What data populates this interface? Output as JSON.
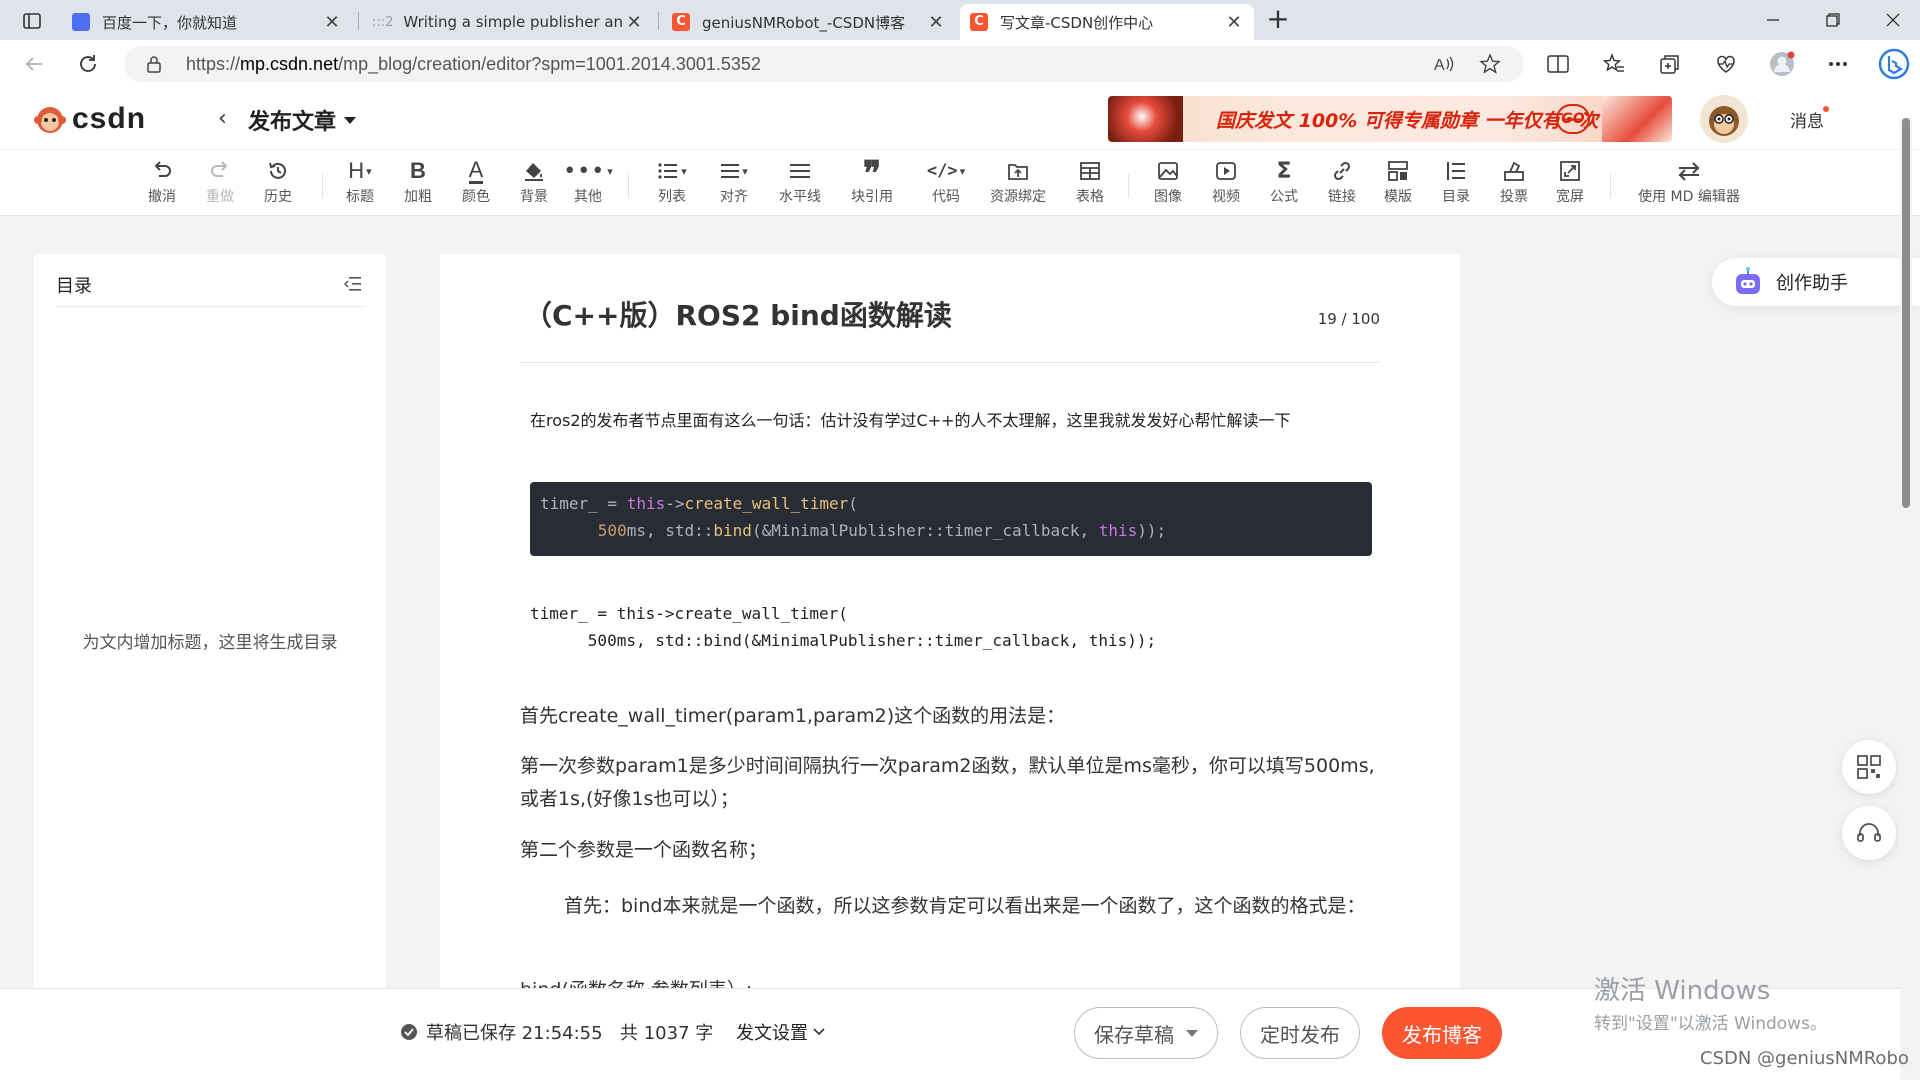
{
  "browser": {
    "tabs": [
      {
        "title": "百度一下，你就知道",
        "favicon_color": "#4e6ef2"
      },
      {
        "title": "Writing a simple publisher and su",
        "favicon_color": "#9aa0a6",
        "prefix": ":::2"
      },
      {
        "title": "geniusNMRobot_-CSDN博客",
        "favicon_color": "#fc5531"
      },
      {
        "title": "写文章-CSDN创作中心",
        "favicon_color": "#fc5531"
      }
    ],
    "url_prefix": "https://",
    "url_domain": "mp.csdn.net",
    "url_rest": "/mp_blog/creation/editor?spm=1001.2014.3001.5352"
  },
  "header": {
    "logo_text": "CSDN",
    "publish_title": "发布文章",
    "banner_text": "国庆发文 100% 可得专属勋章 一年仅有一次",
    "banner_go": "GO",
    "messages": "消息"
  },
  "toolbar": {
    "items": [
      {
        "label": "撤消",
        "icon": "undo-icon"
      },
      {
        "label": "重做",
        "icon": "redo-icon"
      },
      {
        "label": "历史",
        "icon": "history-icon"
      },
      {
        "label": "标题",
        "icon": "heading-icon"
      },
      {
        "label": "加粗",
        "icon": "bold-icon"
      },
      {
        "label": "颜色",
        "icon": "font-color-icon"
      },
      {
        "label": "背景",
        "icon": "background-icon"
      },
      {
        "label": "其他",
        "icon": "more-icon"
      },
      {
        "label": "列表",
        "icon": "list-icon"
      },
      {
        "label": "对齐",
        "icon": "align-icon"
      },
      {
        "label": "水平线",
        "icon": "horizontal-rule-icon"
      },
      {
        "label": "块引用",
        "icon": "blockquote-icon"
      },
      {
        "label": "代码",
        "icon": "code-icon"
      },
      {
        "label": "资源绑定",
        "icon": "resource-icon"
      },
      {
        "label": "表格",
        "icon": "table-icon"
      },
      {
        "label": "图像",
        "icon": "image-icon"
      },
      {
        "label": "视频",
        "icon": "video-icon"
      },
      {
        "label": "公式",
        "icon": "formula-icon"
      },
      {
        "label": "链接",
        "icon": "link-icon"
      },
      {
        "label": "模版",
        "icon": "template-icon"
      },
      {
        "label": "目录",
        "icon": "toc-icon"
      },
      {
        "label": "投票",
        "icon": "vote-icon"
      },
      {
        "label": "宽屏",
        "icon": "widescreen-icon"
      },
      {
        "label": "使用 MD 编辑器",
        "icon": "switch-md-icon"
      }
    ]
  },
  "toc": {
    "title": "目录",
    "empty_hint": "为文内增加标题，这里将生成目录"
  },
  "article": {
    "title": "（C++版）ROS2 bind函数解读",
    "title_count": "19 / 100",
    "intro": "在ros2的发布者节点里面有这么一句话：估计没有学过C++的人不太理解，这里我就发发好心帮忙解读一下",
    "code_lines": [
      "timer_ = this->create_wall_timer(",
      "      500ms, std::bind(&MinimalPublisher::timer_callback, this));"
    ],
    "para1": "首先create_wall_timer(param1,param2)这个函数的用法是：",
    "para2": "第一次参数param1是多少时间间隔执行一次param2函数，默认单位是ms毫秒，你可以填写500ms,或者1s,(好像1s也可以）；",
    "para3": "第二个参数是一个函数名称；",
    "para4": "首先：bind本来就是一个函数，所以这参数肯定可以看出来是一个函数了，这个函数的格式是：",
    "para5": "bind(函数名称,参数列表）;"
  },
  "side": {
    "assistant": "创作助手"
  },
  "footer": {
    "save_status": "草稿已保存 21:54:55",
    "word_count": "共 1037 字",
    "post_settings": "发文设置",
    "save_draft": "保存草稿",
    "timed_publish": "定时发布",
    "publish": "发布博客"
  },
  "os_overlay": {
    "activate_title": "激活 Windows",
    "activate_sub": "转到\"设置\"以激活 Windows。",
    "watermark": "CSDN @geniusNMRobo"
  },
  "colors": {
    "accent": "#fc5531",
    "code_bg": "#282c34"
  }
}
